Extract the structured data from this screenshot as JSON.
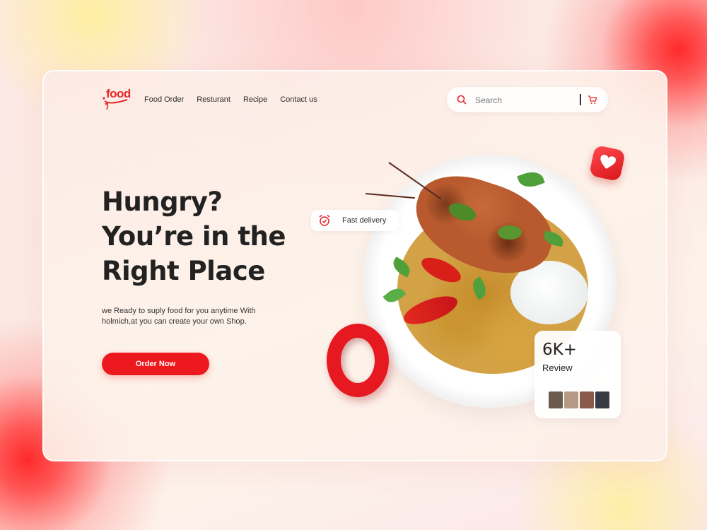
{
  "brand": {
    "logo_text": "food",
    "accent": "#ec1a1f"
  },
  "nav": {
    "items": [
      "Food Order",
      "Resturant",
      "Recipe",
      "Contact us"
    ]
  },
  "search": {
    "placeholder": "Search",
    "value": ""
  },
  "hero": {
    "headline_lines": [
      "Hungry?",
      "You’re in the",
      "Right Place"
    ],
    "description": "we Ready to suply food for you anytime With holmich,at you can create your own Shop.",
    "cta_label": "Order Now"
  },
  "badges": {
    "delivery_label": "Fast delivery"
  },
  "reviews": {
    "count": "6K+",
    "label": "Review",
    "avatar_colors": [
      "#6b5a4c",
      "#b79a86",
      "#8a5a4a",
      "#3a3a44"
    ]
  },
  "icons": {
    "search": "search-icon",
    "cart": "cart-icon",
    "alarm": "alarm-clock-icon",
    "heart": "heart-icon"
  }
}
